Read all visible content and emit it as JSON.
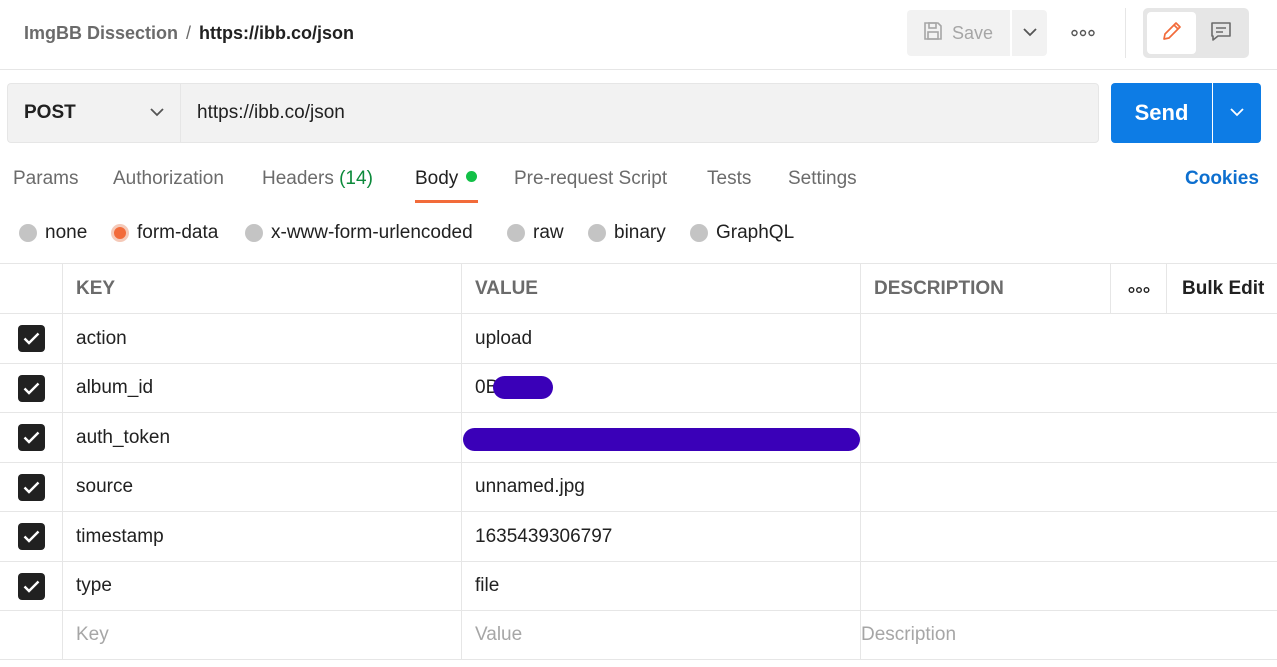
{
  "header": {
    "breadcrumb_parent": "ImgBB Dissection",
    "breadcrumb_separator": "/",
    "breadcrumb_current": "https://ibb.co/json",
    "save_label": "Save"
  },
  "request": {
    "method": "POST",
    "url": "https://ibb.co/json",
    "send_label": "Send"
  },
  "tabs": [
    {
      "label": "Params"
    },
    {
      "label": "Authorization"
    },
    {
      "label": "Headers",
      "count": "(14)"
    },
    {
      "label": "Body"
    },
    {
      "label": "Pre-request Script"
    },
    {
      "label": "Tests"
    },
    {
      "label": "Settings"
    }
  ],
  "cookies_label": "Cookies",
  "body_types": [
    "none",
    "form-data",
    "x-www-form-urlencoded",
    "raw",
    "binary",
    "GraphQL"
  ],
  "body_type_selected": "form-data",
  "table": {
    "headers": {
      "key": "KEY",
      "value": "VALUE",
      "description": "DESCRIPTION",
      "bulk_edit": "Bulk Edit"
    },
    "rows": [
      {
        "key": "action",
        "value": "upload",
        "checked": true
      },
      {
        "key": "album_id",
        "value": "0B",
        "checked": true
      },
      {
        "key": "auth_token",
        "value": "",
        "checked": true
      },
      {
        "key": "source",
        "value": "unnamed.jpg",
        "checked": true
      },
      {
        "key": "timestamp",
        "value": "1635439306797",
        "checked": true
      },
      {
        "key": "type",
        "value": "file",
        "checked": true
      }
    ],
    "placeholders": {
      "key": "Key",
      "value": "Value",
      "description": "Description"
    }
  },
  "colors": {
    "accent": "#f26b3a",
    "send_blue": "#0d7ce5",
    "active_dot": "#12c047",
    "redaction": "#3a00b8"
  }
}
